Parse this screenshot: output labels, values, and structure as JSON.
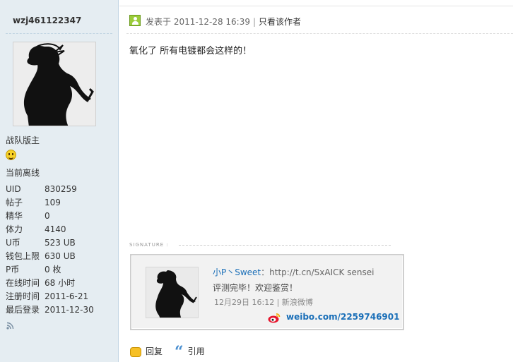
{
  "profile": {
    "username": "wzj461122347",
    "role": "战队版主",
    "online_status": "当前离线",
    "stats": [
      {
        "label": "UID",
        "value": "830259"
      },
      {
        "label": "帖子",
        "value": "109"
      },
      {
        "label": "精华",
        "value": "0"
      },
      {
        "label": "体力",
        "value": "4140"
      },
      {
        "label": "U币",
        "value": "523 UB"
      },
      {
        "label": "钱包上限",
        "value": "630 UB"
      },
      {
        "label": "P币",
        "value": "0 枚"
      },
      {
        "label": "在线时间",
        "value": "68 小时"
      },
      {
        "label": "注册时间",
        "value": "2011-6-21"
      },
      {
        "label": "最后登录",
        "value": "2011-12-30"
      }
    ]
  },
  "post": {
    "posted_label": "发表于",
    "posted_time": "2011-12-28 16:39",
    "author_only_link": "只看该作者",
    "content": "氧化了  所有电镀都会这样的！"
  },
  "signature": {
    "label": "SIGNATURE :",
    "name": "小P丶Sweet",
    "colon": "：",
    "url": "http://t.cn/SxAICK sensei",
    "message": "评测完毕！欢迎鉴赏！",
    "meta": "12月29日 16:12 | 新浪微博",
    "weibo_link": "weibo.com/2259746901"
  },
  "actions": {
    "reply": "回复",
    "quote": "引用"
  }
}
